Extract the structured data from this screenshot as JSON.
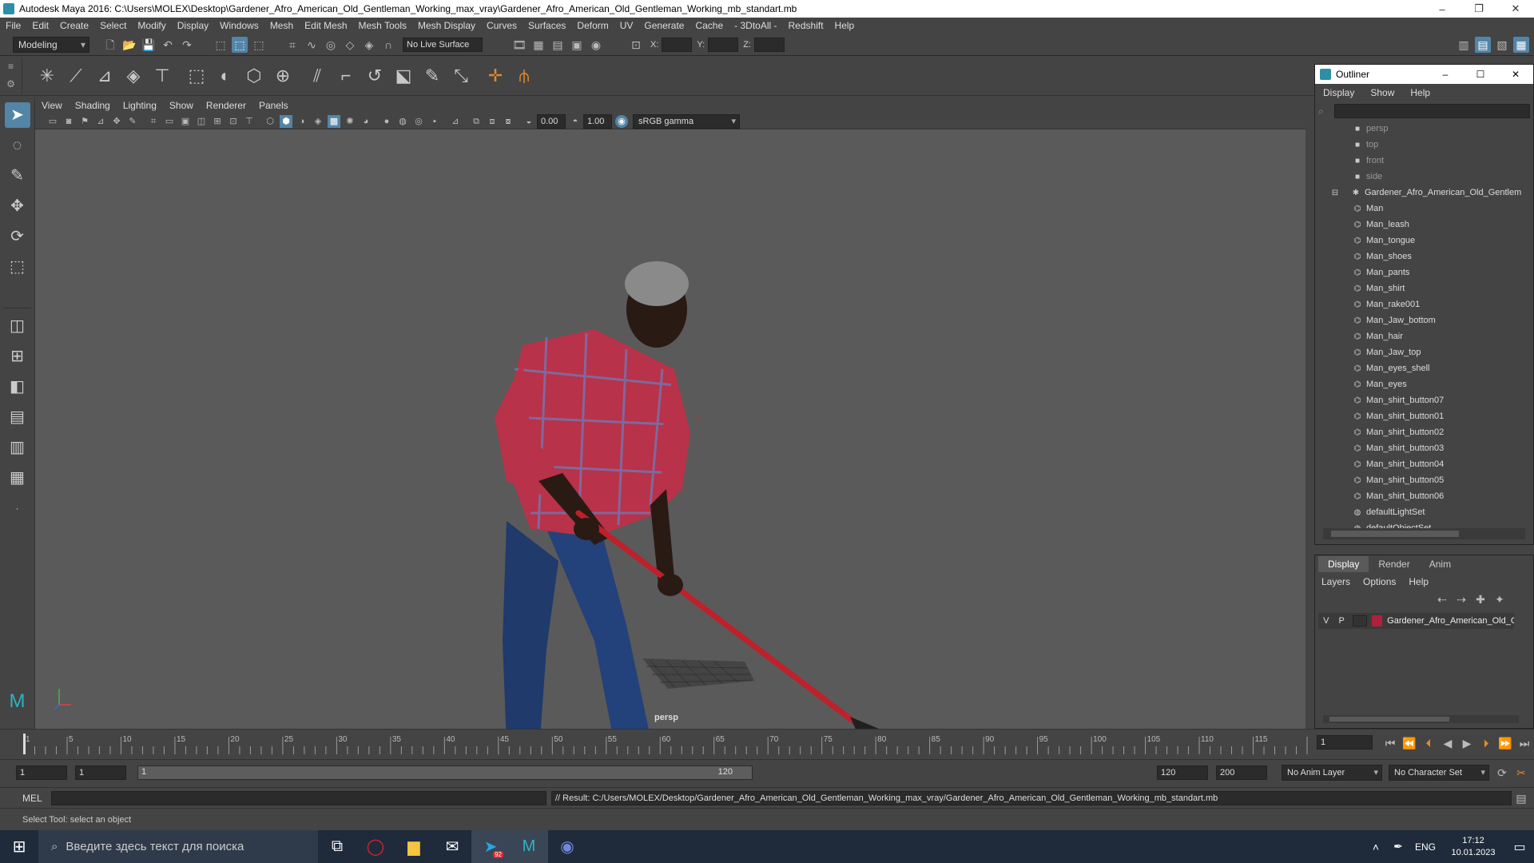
{
  "window": {
    "title": "Autodesk Maya 2016: C:\\Users\\MOLEX\\Desktop\\Gardener_Afro_American_Old_Gentleman_Working_max_vray\\Gardener_Afro_American_Old_Gentleman_Working_mb_standart.mb",
    "minimize": "–",
    "restore": "❐",
    "close": "✕"
  },
  "menubar": [
    "File",
    "Edit",
    "Create",
    "Select",
    "Modify",
    "Display",
    "Windows",
    "Mesh",
    "Edit Mesh",
    "Mesh Tools",
    "Mesh Display",
    "Curves",
    "Surfaces",
    "Deform",
    "UV",
    "Generate",
    "Cache",
    "- 3DtoAll -",
    "Redshift",
    "Help"
  ],
  "statusline": {
    "mode": "Modeling",
    "live_surface": "No Live Surface",
    "x_label": "X:",
    "y_label": "Y:",
    "z_label": "Z:"
  },
  "panel": {
    "menus": [
      "View",
      "Shading",
      "Lighting",
      "Show",
      "Renderer",
      "Panels"
    ],
    "exposure": "0.00",
    "gamma": "1.00",
    "colorspace": "sRGB gamma",
    "camera": "persp"
  },
  "timeline": {
    "ticks": [
      "1",
      "5",
      "10",
      "15",
      "20",
      "25",
      "30",
      "35",
      "40",
      "45",
      "50",
      "55",
      "60",
      "65",
      "70",
      "75",
      "80",
      "85",
      "90",
      "95",
      "100",
      "105",
      "110",
      "115",
      "120"
    ],
    "current_frame": "1"
  },
  "range": {
    "start": "1",
    "start2": "1",
    "slider_start": "1",
    "slider_end": "120",
    "end": "120",
    "end2": "200",
    "anim_layer": "No Anim Layer",
    "char_set": "No Character Set"
  },
  "cmd": {
    "lang": "MEL",
    "result": "// Result: C:/Users/MOLEX/Desktop/Gardener_Afro_American_Old_Gentleman_Working_max_vray/Gardener_Afro_American_Old_Gentleman_Working_mb_standart.mb"
  },
  "help_line": "Select Tool: select an object",
  "outliner": {
    "title": "Outliner",
    "menus": [
      "Display",
      "Show",
      "Help"
    ],
    "cameras": [
      "persp",
      "top",
      "front",
      "side"
    ],
    "root": "Gardener_Afro_American_Old_Gentlem",
    "children": [
      "Man",
      "Man_leash",
      "Man_tongue",
      "Man_shoes",
      "Man_pants",
      "Man_shirt",
      "Man_rake001",
      "Man_Jaw_bottom",
      "Man_hair",
      "Man_Jaw_top",
      "Man_eyes_shell",
      "Man_eyes",
      "Man_shirt_button07",
      "Man_shirt_button01",
      "Man_shirt_button02",
      "Man_shirt_button03",
      "Man_shirt_button04",
      "Man_shirt_button05",
      "Man_shirt_button06"
    ],
    "sets": [
      "defaultLightSet",
      "defaultObjectSet"
    ]
  },
  "layers": {
    "tabs": [
      "Display",
      "Render",
      "Anim"
    ],
    "menus": [
      "Layers",
      "Options",
      "Help"
    ],
    "v": "V",
    "p": "P",
    "layer_name": "Gardener_Afro_American_Old_G",
    "layer_color": "#b0203a"
  },
  "taskbar": {
    "search": "Введите здесь текст для поиска",
    "lang": "ENG",
    "time": "17:12",
    "date": "10.01.2023",
    "badge": "92"
  },
  "colors": {
    "accent": "#5285a6",
    "viewport": "#5a5a5a"
  }
}
